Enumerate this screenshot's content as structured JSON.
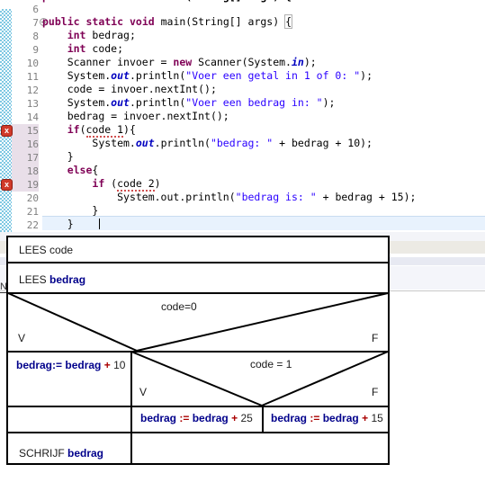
{
  "editor": {
    "language": "Java",
    "first_visible_line": 6,
    "last_visible_line": 22,
    "current_line": 22,
    "error_lines": [
      15,
      19
    ],
    "truncated_top_line": "public static void main(String[] args) {",
    "lines": [
      {
        "no": "6",
        "text": ""
      },
      {
        "no": "7",
        "text": "    public static void main(String[] args) {"
      },
      {
        "no": "8",
        "text": "        int bedrag;"
      },
      {
        "no": "9",
        "text": "        int code;"
      },
      {
        "no": "10",
        "text": "        Scanner invoer = new Scanner(System.in);"
      },
      {
        "no": "11",
        "text": "        System.out.println(\"Voer een getal in 1 of 0: \");"
      },
      {
        "no": "12",
        "text": "        code = invoer.nextInt();"
      },
      {
        "no": "13",
        "text": "        System.out.println(\"Voer een bedrag in: \");"
      },
      {
        "no": "14",
        "text": "        bedrag = invoer.nextInt();"
      },
      {
        "no": "15",
        "text": "        if(code 1){"
      },
      {
        "no": "16",
        "text": "            System.out.println(\"bedrag: \" + bedrag + 10);"
      },
      {
        "no": "17",
        "text": "        }"
      },
      {
        "no": "18",
        "text": "        else{"
      },
      {
        "no": "19",
        "text": "            if (code 2)"
      },
      {
        "no": "20",
        "text": "                System.out.println(\"bedrag is: \" + bedrag + 15);"
      },
      {
        "no": "21",
        "text": "        }"
      },
      {
        "no": "22",
        "text": "    }"
      }
    ],
    "error_marker_glyph": "x",
    "fold_icon": "fold-collapse-icon",
    "colors": {
      "keyword": "#7f0055",
      "string": "#2a00ff",
      "field": "#0000c0",
      "plain": "#000000",
      "current_line_highlight": "#e8f2fd",
      "error_marker": "#d03a2a",
      "annotation_strip": "#7ec8e3"
    }
  },
  "diagram": {
    "type": "nassi-shneiderman",
    "peek_label": "N",
    "rows": [
      {
        "id": "read-code",
        "kind": "process",
        "text_plain": "LEES ",
        "text_bold": "code",
        "bold_color": "#1a1a1a"
      },
      {
        "id": "read-bedrag",
        "kind": "process",
        "text_plain": "LEES ",
        "text_bold": "bedrag",
        "bold_color": "#00008b"
      }
    ],
    "outer_decision": {
      "condition": "code=0",
      "true_label": "V",
      "false_label": "F",
      "true_branch": {
        "id": "assign-10",
        "var": "bedrag",
        "assign_op": ":=",
        "expr_var": "bedrag",
        "operator": "+",
        "operand": "10"
      }
    },
    "inner_decision": {
      "condition": "code = 1",
      "true_label": "V",
      "false_label": "F",
      "true_branch": {
        "id": "assign-25",
        "var": "bedrag",
        "assign_op": ":=",
        "expr_var": "bedrag",
        "operator": "+",
        "operand": "25"
      },
      "false_branch": {
        "id": "assign-15",
        "var": "bedrag",
        "assign_op": ":=",
        "expr_var": "bedrag",
        "operator": "+",
        "operand": "15"
      }
    },
    "footer": {
      "id": "write-bedrag",
      "text_plain": "SCHRIJF ",
      "text_bold": "bedrag",
      "bold_color": "#00008b"
    },
    "colors": {
      "stroke": "#000000",
      "variable": "#00008b",
      "operator": "#aa0000",
      "number": "#222222"
    }
  }
}
